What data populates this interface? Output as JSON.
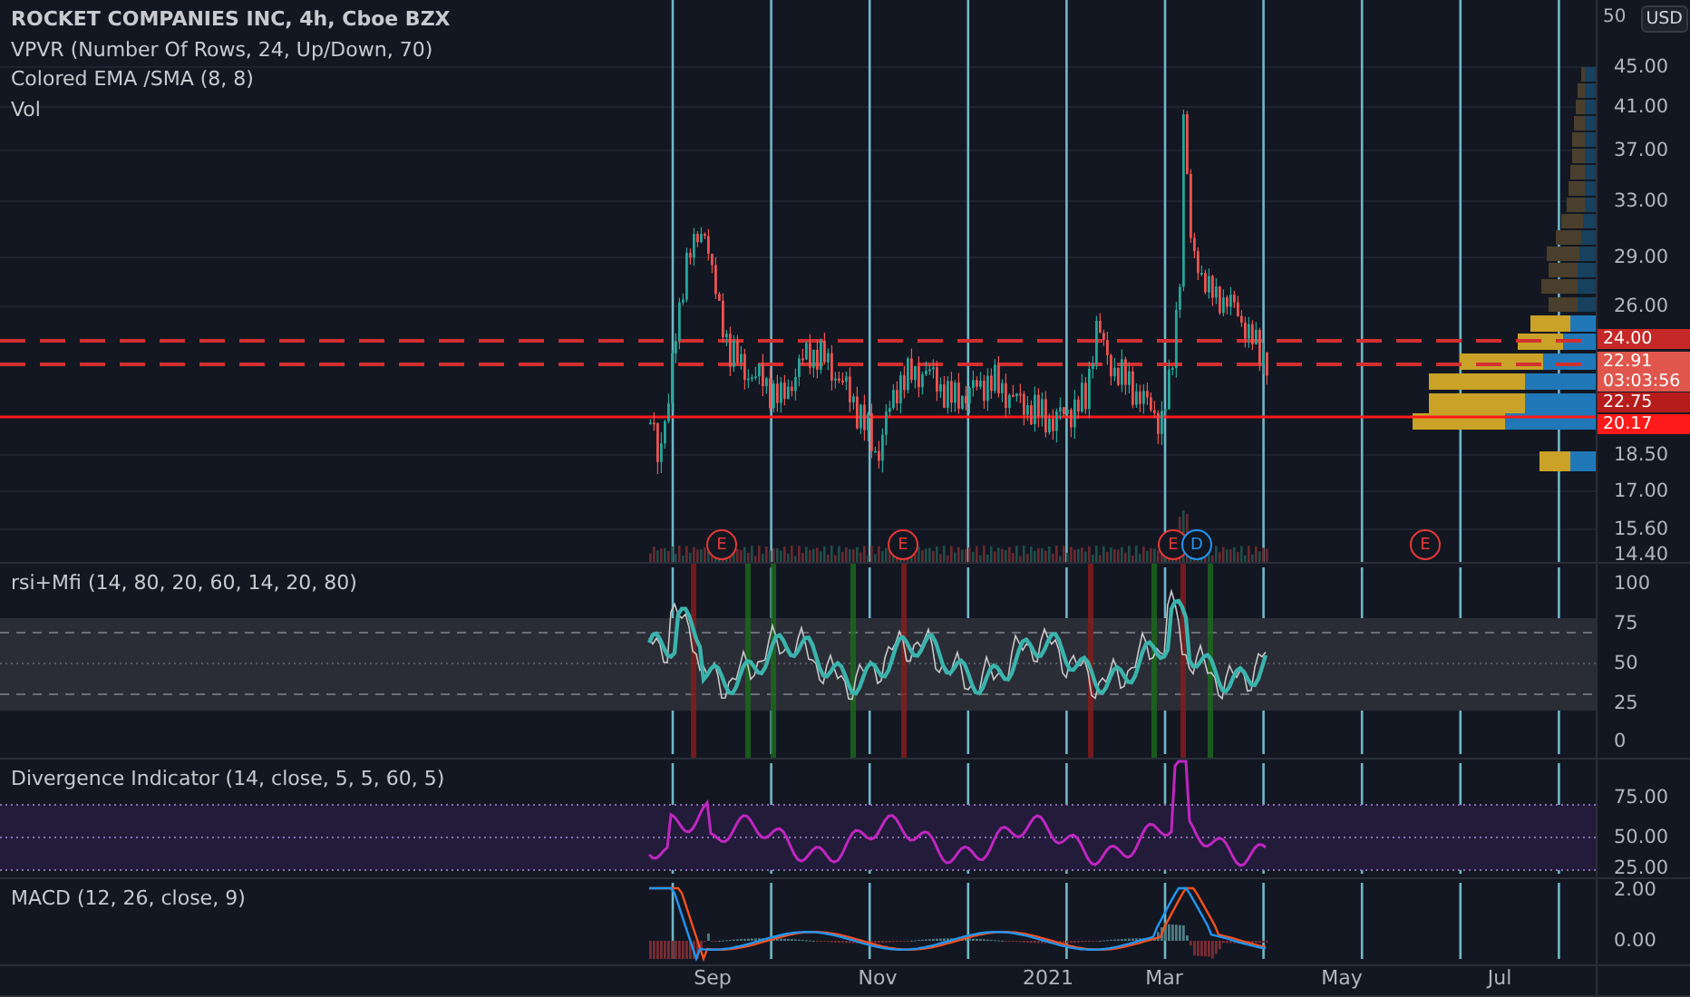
{
  "legend": {
    "title": "ROCKET COMPANIES INC, 4h, Cboe BZX",
    "studies": [
      "VPVR (Number Of Rows, 24, Up/Down, 70)",
      "Colored EMA /SMA (8, 8)",
      "Vol"
    ]
  },
  "price_axis": {
    "currency": "USD",
    "ticks": [
      "50",
      "45.00",
      "41.00",
      "37.00",
      "33.00",
      "29.00",
      "26.00",
      "18.50",
      "17.00",
      "15.60",
      "14.40"
    ]
  },
  "price_labels": [
    {
      "text": "24.00",
      "color": "#c62828"
    },
    {
      "text": "22.91",
      "sub": "03:03:56",
      "color": "#e0564c"
    },
    {
      "text": "22.75",
      "color": "#b71c1c"
    },
    {
      "text": "20.17",
      "color": "#ff1a1a"
    }
  ],
  "events": [
    {
      "letter": "E",
      "color": "#e53935"
    },
    {
      "letter": "E",
      "color": "#e53935"
    },
    {
      "letter": "E",
      "color": "#e53935"
    },
    {
      "letter": "D",
      "color": "#2196f3"
    },
    {
      "letter": "E",
      "color": "#e53935"
    }
  ],
  "rsi": {
    "title": "rsi+Mfi (14, 80, 20, 60, 14, 20, 80)",
    "ticks": [
      "100",
      "75",
      "50",
      "25",
      "0"
    ]
  },
  "divergence": {
    "title": "Divergence Indicator (14, close, 5, 5, 60, 5)",
    "ticks": [
      "75.00",
      "50.00",
      "25.00"
    ]
  },
  "macd": {
    "title": "MACD (12, 26, close, 9)",
    "ticks": [
      "2.00",
      "0.00"
    ]
  },
  "time_axis": [
    "Sep",
    "Nov",
    "2021",
    "Mar",
    "May",
    "Jul"
  ]
}
